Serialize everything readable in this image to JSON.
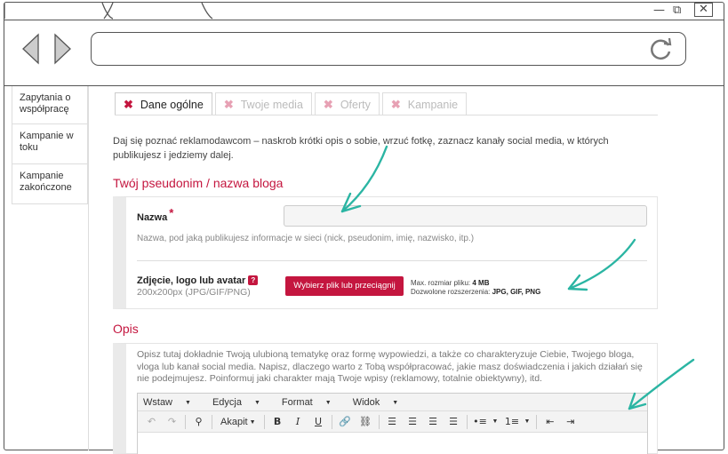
{
  "browser": {
    "controls": {
      "minimize": "—",
      "maximize": "⧉",
      "close": "✕"
    }
  },
  "sidebar": {
    "items": [
      {
        "label": "Zapytania o współpracę"
      },
      {
        "label": "Kampanie w toku"
      },
      {
        "label": "Kampanie zakończone"
      }
    ]
  },
  "tabs": [
    {
      "label": "Dane ogólne",
      "active": true
    },
    {
      "label": "Twoje media",
      "active": false
    },
    {
      "label": "Oferty",
      "active": false
    },
    {
      "label": "Kampanie",
      "active": false
    }
  ],
  "tab_close_symbol": "✖",
  "intro": "Daj się poznać reklamodawcom – naskrob krótki opis o sobie, wrzuć fotkę, zaznacz kanały social media, w których publikujesz i jedziemy dalej.",
  "section1": {
    "title": "Twój pseudonim / nazwa bloga",
    "name_label": "Nazwa",
    "required_mark": "*",
    "name_value": "",
    "name_hint": "Nazwa, pod jaką publikujesz informacje w sieci (nick, pseudonim, imię, nazwisko, itp.)",
    "photo_label": "Zdjęcie, logo lub avatar",
    "photo_help": "?",
    "photo_size": "200x200px  (JPG/GIF/PNG)",
    "upload_button": "Wybierz plik lub przeciągnij",
    "max_size_label": "Max. rozmiar pliku:",
    "max_size_value": "4 MB",
    "ext_label": "Dozwolone rozszerzenia:",
    "ext_value": "JPG, GIF, PNG"
  },
  "section2": {
    "title": "Opis",
    "description": "Opisz tutaj dokładnie Twoją ulubioną tematykę oraz formę wypowiedzi, a także co charakteryzuje Ciebie, Twojego bloga, vloga lub kanał social media. Napisz, dlaczego warto z Tobą współpracować, jakie masz doświadczenia i jakich działań się nie podejmujesz. Poinformuj jaki charakter mają Twoje wpisy (reklamowy, totalnie obiektywny), itd.",
    "menu": [
      "Wstaw",
      "Edycja",
      "Format",
      "Widok"
    ],
    "font_dropdown": "Akapit",
    "toolbar": {
      "undo": "↶",
      "redo": "↷",
      "find": "⚲",
      "bold": "B",
      "italic": "I",
      "underline": "U",
      "link": "🔗",
      "unlink": "⛓",
      "align_left": "☰",
      "align_center": "☰",
      "align_right": "☰",
      "justify": "☰",
      "bullets": "•≡",
      "numbered": "1≡",
      "outdent": "⇤",
      "indent": "⇥"
    }
  },
  "colors": {
    "accent": "#c4163f",
    "annotation": "#2bb5a3"
  }
}
